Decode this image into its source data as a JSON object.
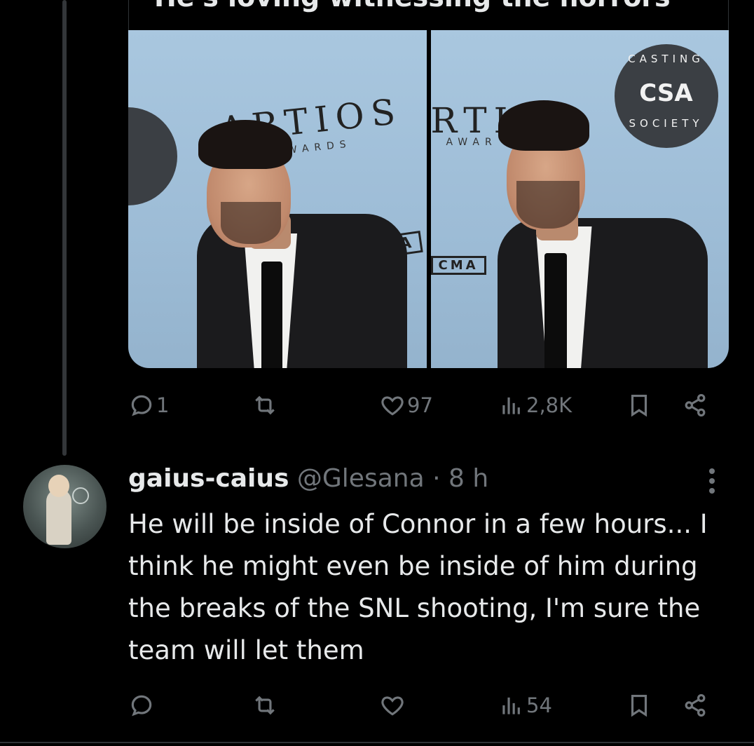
{
  "quoted_top_text": "He's loving witnessing the horrors",
  "media": {
    "left_photo": {
      "backdrop_logo": "ARTIOS",
      "backdrop_sub": "AWARDS",
      "sponsor": "CMA"
    },
    "right_photo": {
      "backdrop_logo": "RTIOS",
      "backdrop_sub": "AWAR",
      "sponsor": "CMA",
      "seal_top": "CASTING",
      "seal_center": "CSA",
      "seal_bottom": "SOCIETY"
    }
  },
  "tweet_actions": {
    "reply_icon": "reply-icon",
    "reply_count": "1",
    "retweet_icon": "retweet-icon",
    "like_icon": "heart-icon",
    "like_count": "97",
    "views_icon": "views-icon",
    "views_count": "2,8K",
    "bookmark_icon": "bookmark-icon",
    "share_icon": "share-icon"
  },
  "reply": {
    "display_name": "gaius-caius",
    "handle": "@Glesana",
    "separator": "·",
    "time": "8 h",
    "text": "He will be inside of Connor in a few hours... I think he might even be inside of him during the breaks of the SNL shooting, I'm sure the team will let them",
    "actions": {
      "reply_count": "",
      "like_count": "",
      "views_count": "54"
    }
  },
  "colors": {
    "background": "#000000",
    "text_primary": "#e7e9ea",
    "text_secondary": "#71767b",
    "divider": "#2f3336"
  }
}
